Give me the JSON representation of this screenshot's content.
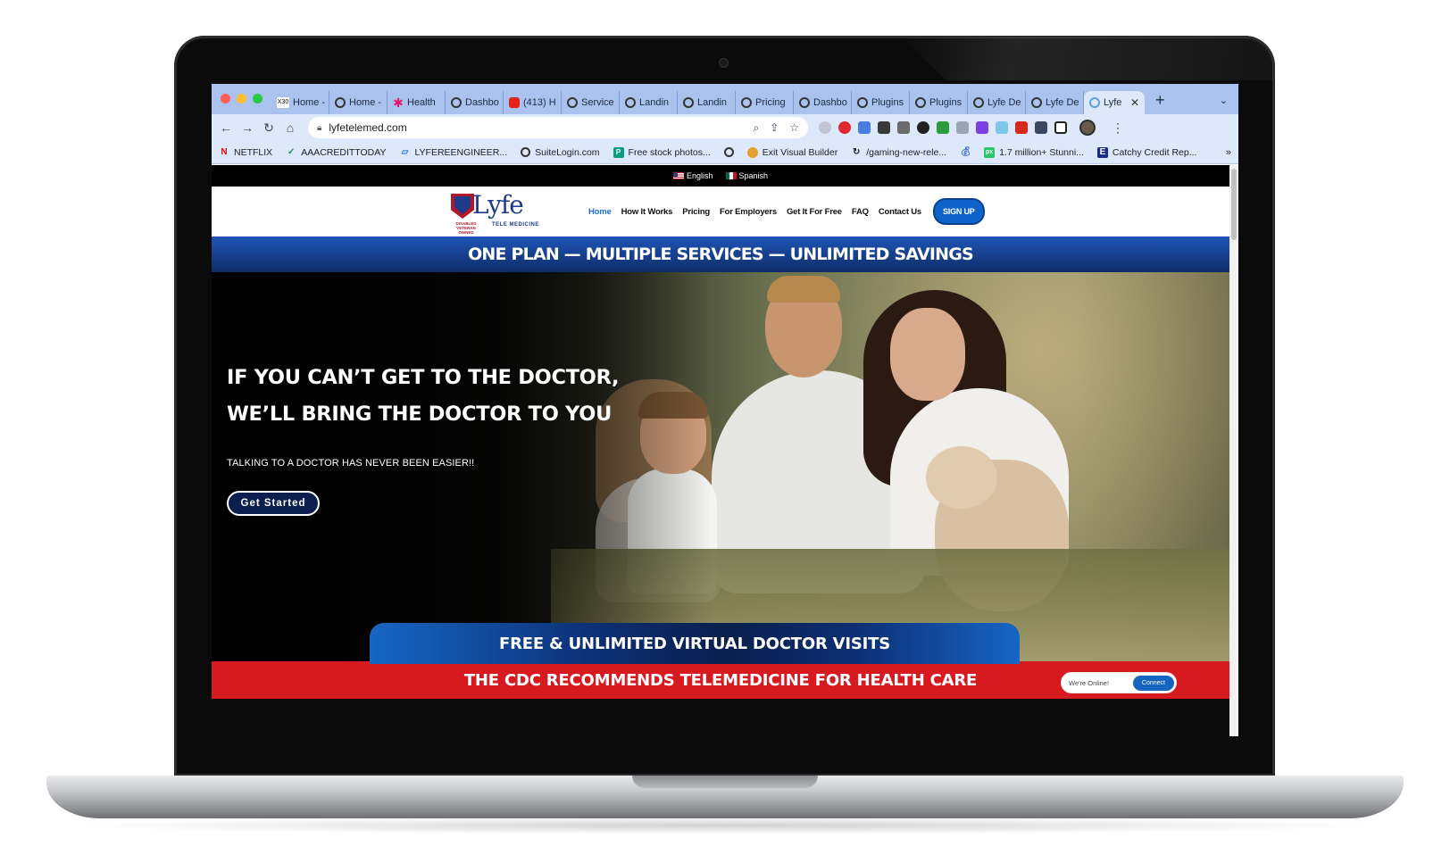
{
  "browser": {
    "tabs": [
      {
        "label": "Home -",
        "icon": "x30-icon"
      },
      {
        "label": "Home -",
        "icon": "globe-icon"
      },
      {
        "label": "Health",
        "icon": "asterisk-icon"
      },
      {
        "label": "Dashbo",
        "icon": "globe-icon"
      },
      {
        "label": "(413) H",
        "icon": "youtube-icon"
      },
      {
        "label": "Service",
        "icon": "globe-icon"
      },
      {
        "label": "Landin",
        "icon": "globe-icon"
      },
      {
        "label": "Landin",
        "icon": "globe-icon"
      },
      {
        "label": "Pricing",
        "icon": "globe-icon"
      },
      {
        "label": "Dashbo",
        "icon": "globe-icon"
      },
      {
        "label": "Plugins",
        "icon": "globe-icon"
      },
      {
        "label": "Plugins",
        "icon": "globe-icon"
      },
      {
        "label": "Lyfe De",
        "icon": "globe-icon"
      },
      {
        "label": "Lyfe De",
        "icon": "globe-icon"
      },
      {
        "label": "Lyfe",
        "icon": "globe-icon",
        "active": true
      }
    ],
    "url": "lyfetelemed.com",
    "bookmarks": [
      {
        "label": "NETFLIX",
        "icon": "netflix-icon",
        "color": "#e50914"
      },
      {
        "label": "AAACREDITTODAY",
        "icon": "check-icon",
        "color": "#2e8b57"
      },
      {
        "label": "LYFEREENGINEER...",
        "icon": "stripe-icon",
        "color": "#1e6fd9"
      },
      {
        "label": "SuiteLogin.com",
        "icon": "globe-icon",
        "color": "#333333"
      },
      {
        "label": "Free stock photos...",
        "icon": "pexels-icon",
        "color": "#05a081"
      },
      {
        "label": "",
        "icon": "globe-icon",
        "color": "#333333"
      },
      {
        "label": "Exit Visual Builder",
        "icon": "divi-icon",
        "color": "#e2a02c"
      },
      {
        "label": "/gaming-new-rele...",
        "icon": "loading-icon",
        "color": "#333333"
      },
      {
        "label": "",
        "icon": "bag-icon",
        "color": "#3563c9"
      },
      {
        "label": "1.7 million+ Stunni...",
        "icon": "pixabay-icon",
        "color": "#2ec66d"
      },
      {
        "label": "Catchy Credit Rep...",
        "icon": "e-icon",
        "color": "#1b2a8f"
      }
    ],
    "bookmarks_more": "»"
  },
  "site": {
    "lang": {
      "english": "English",
      "spanish": "Spanish"
    },
    "logo": {
      "wordmark": "Lyfe",
      "sub": "TELE MEDICINE",
      "badge": "DISABLED VETERAN OWNED"
    },
    "menu": {
      "home": "Home",
      "how": "How It Works",
      "pricing": "Pricing",
      "employers": "For Employers",
      "free": "Get It For Free",
      "faq": "FAQ",
      "contact": "Contact Us",
      "signup": "SIGN UP"
    },
    "promo": "ONE PLAN — MULTIPLE SERVICES — UNLIMITED SAVINGS",
    "hero": {
      "title_line1": "IF YOU CAN’T GET TO THE DOCTOR,",
      "title_line2": "WE’LL BRING THE DOCTOR TO YOU",
      "subtitle": "TALKING TO A DOCTOR HAS NEVER BEEN EASIER!!",
      "cta": "Get Started"
    },
    "visits_banner": "FREE & UNLIMITED VIRTUAL DOCTOR VISITS",
    "cdc_banner": "THE CDC RECOMMENDS TELEMEDICINE FOR HEALTH CARE",
    "chat": {
      "status": "We're Online!",
      "button": "Connect"
    }
  },
  "colors": {
    "tabstrip": "#a9c3ee",
    "nav_active": "#1e6fd9",
    "signup": "#0d63c9",
    "promo_band": "#153d88",
    "cdc_red": "#d71a20",
    "cta_bg": "#0a1f4d"
  }
}
